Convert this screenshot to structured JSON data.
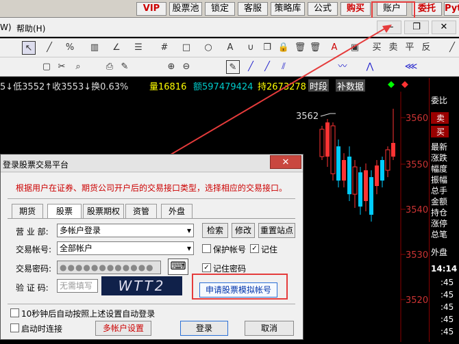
{
  "topbar": {
    "vip": "VIP",
    "stock_pool": "股票池",
    "lock": "锁定",
    "service": "客服",
    "strategy": "策略库",
    "formula": "公式",
    "buy": "购买",
    "account": "账户",
    "order": "委托",
    "python": "Pyt"
  },
  "menu": {
    "w": "W)",
    "help": "帮助(H)"
  },
  "quote": {
    "v1": "5↓低3552↑收3553↓换0.63%",
    "vol": "量16816",
    "amt": "额597479424",
    "hold": "持2673278",
    "period": "时段",
    "fill": "补数据"
  },
  "chart": {
    "peak_label": "3562",
    "y_ticks": [
      "3560",
      "3550",
      "3540",
      "3530",
      "3520"
    ]
  },
  "right_panel": {
    "items": [
      "委比",
      "卖",
      "买",
      "最新",
      "涨跌",
      "幅度",
      "振幅",
      "总手",
      "金额",
      "持仓",
      "涨停",
      "总笔",
      "外盘"
    ],
    "time": "14:14",
    "sec": [
      ":45",
      ":45",
      ":45",
      ":45",
      ":45"
    ]
  },
  "dialog": {
    "title": "登录股票交易平台",
    "close": "✕",
    "notice": "根据用户在证券、期货公司开户后的交易接口类型，选择相应的交易接口。",
    "tabs": [
      "期货",
      "股票",
      "股票期权",
      "资管",
      "外盘"
    ],
    "branch_label": "营 业 部:",
    "branch_value": "多帐户登录",
    "search_btn": "检索",
    "modify_btn": "修改",
    "reset_btn": "重置站点",
    "account_label": "交易帐号:",
    "account_value": "全部帐户",
    "protect_account": "保护帐号",
    "remember": "记住",
    "password_label": "交易密码:",
    "password_value": "●●●●●●●●●●●●",
    "remember_pwd": "记住密码",
    "captcha_label": "验 证 码:",
    "captcha_placeholder": "无需填写",
    "captcha_image_text": "WTT2",
    "apply_sim": "申请股票模拟帐号",
    "auto_login": "10秒钟后自动按照上述设置自动登录",
    "auto_connect": "启动时连接",
    "multi_account": "多帐户设置",
    "login": "登录",
    "cancel": "取消"
  }
}
